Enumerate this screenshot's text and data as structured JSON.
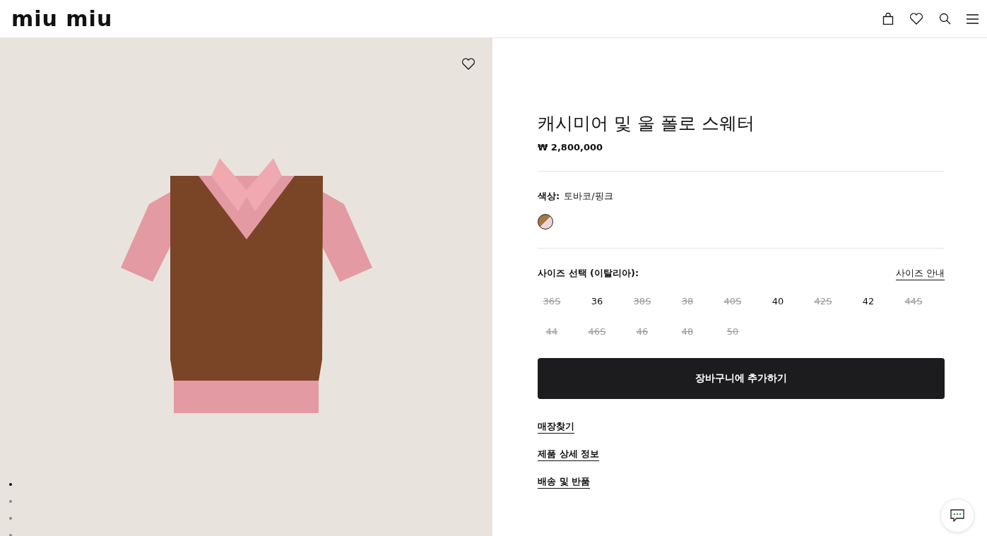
{
  "header": {
    "logo": "miu miu"
  },
  "gallery": {
    "favorite": false,
    "slides": [
      {
        "selected": true
      },
      {
        "selected": false
      },
      {
        "selected": false
      },
      {
        "selected": false
      }
    ]
  },
  "product": {
    "title": "캐시미어 및 울 폴로 스웨터",
    "price": "₩ 2,800,000"
  },
  "color": {
    "label": "색상:",
    "value": "토바코/핑크",
    "swatches": [
      {
        "selected": true,
        "color": "#a97840"
      }
    ]
  },
  "size": {
    "label": "사이즈 선택 (이탈리아):",
    "guide": "사이즈 안내",
    "options": [
      {
        "label": "36S",
        "available": false
      },
      {
        "label": "36",
        "available": true
      },
      {
        "label": "38S",
        "available": false
      },
      {
        "label": "38",
        "available": false
      },
      {
        "label": "40S",
        "available": false
      },
      {
        "label": "40",
        "available": true
      },
      {
        "label": "42S",
        "available": false
      },
      {
        "label": "42",
        "available": true
      },
      {
        "label": "44S",
        "available": false
      },
      {
        "label": "44",
        "available": false
      },
      {
        "label": "46S",
        "available": false
      },
      {
        "label": "46",
        "available": false
      },
      {
        "label": "48",
        "available": false
      },
      {
        "label": "50",
        "available": false
      }
    ]
  },
  "add_to_cart": "장바구니에 추가하기",
  "links": [
    "매장찾기",
    "제품 상세 정보",
    "배송 및 반품"
  ]
}
